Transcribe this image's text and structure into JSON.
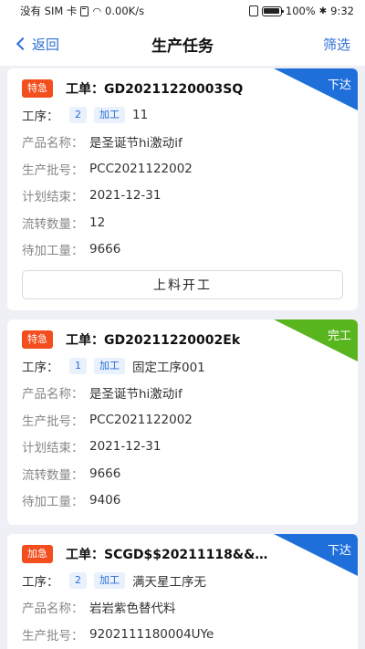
{
  "status_bar": {
    "carrier": "没有 SIM 卡",
    "speed": "0.00K/s",
    "battery": "100%",
    "time": "9:32"
  },
  "nav": {
    "back_label": "返回",
    "title": "生产任务",
    "filter_label": "筛选"
  },
  "labels": {
    "order_prefix": "工单：",
    "process": "工序：",
    "product_name": "产品名称：",
    "batch_no": "生产批号：",
    "plan_end": "计划结束：",
    "transfer_qty": "流转数量：",
    "pending_qty": "待加工量："
  },
  "cards": [
    {
      "priority": "特急",
      "order_no": "GD20211220003SQ",
      "corner": "下达",
      "corner_color": "#1f6fdb",
      "process_seq": "2",
      "process_type": "加工",
      "process_name": "11",
      "product_name": "是圣诞节hi激动if",
      "batch_no": "PCC2021122002",
      "plan_end": "2021-12-31",
      "transfer_qty": "12",
      "pending_qty": "9666",
      "action": "上料开工"
    },
    {
      "priority": "特急",
      "order_no": "GD20211220002Ek",
      "corner": "完工",
      "corner_color": "#59b51e",
      "process_seq": "1",
      "process_type": "加工",
      "process_name": "固定工序001",
      "product_name": "是圣诞节hi激动if",
      "batch_no": "PCC2021122002",
      "plan_end": "2021-12-31",
      "transfer_qty": "9666",
      "pending_qty": "9406"
    },
    {
      "priority": "加急",
      "order_no": "SCGD$$20211118&&0...",
      "corner": "下达",
      "corner_color": "#1f6fdb",
      "process_seq": "2",
      "process_type": "加工",
      "process_name": "满天星工序无",
      "product_name": "岩岩紫色替代料",
      "batch_no": "9202111180004UYe"
    }
  ],
  "colors": {
    "accent": "#2c6fd6",
    "badge": "#f24e1e",
    "background": "#eef0f5"
  }
}
